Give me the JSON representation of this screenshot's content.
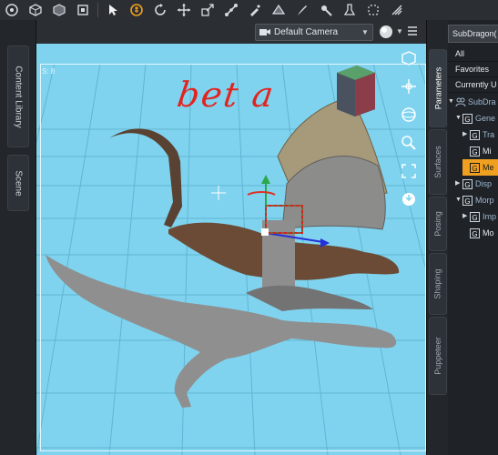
{
  "toolbar": {
    "items": [
      {
        "icon": "universal-tool-icon"
      },
      {
        "icon": "node-cube-icon"
      },
      {
        "icon": "surface-cube-icon"
      },
      {
        "icon": "region-cube-icon"
      },
      {
        "icon": "pointer-arrow-icon"
      },
      {
        "icon": "active-pose-icon"
      },
      {
        "icon": "rotate-icon"
      },
      {
        "icon": "translate-icon"
      },
      {
        "icon": "scale-icon"
      },
      {
        "icon": "joint-editor-icon"
      },
      {
        "icon": "geometry-sculptor-icon"
      },
      {
        "icon": "surface-selection-icon"
      },
      {
        "icon": "node-weight-brush-icon"
      },
      {
        "icon": "geometry-editor-icon"
      },
      {
        "icon": "spot-render-icon"
      },
      {
        "icon": "shape-move-icon"
      },
      {
        "icon": "more-tools-icon"
      }
    ]
  },
  "left_dock": {
    "tabs": [
      "Content Library",
      "Scene"
    ]
  },
  "viewport": {
    "camera_label": "Default Camera",
    "frame_label": "S: 8",
    "annotation": "bet a",
    "nav_icons": [
      "perspective-cube-icon",
      "pan-icon",
      "orbit-icon",
      "zoom-icon",
      "frame-icon",
      "reset-icon"
    ]
  },
  "right_tabs": [
    "Parameters",
    "Surfaces",
    "Posing",
    "Shaping",
    "Puppeteer"
  ],
  "params": {
    "node_title": "SubDragon(",
    "filters": [
      "All",
      "Favorites",
      "Currently U"
    ],
    "tree": [
      {
        "label": "SubDra",
        "indent": 0,
        "icon": "figure",
        "expand": "▼"
      },
      {
        "label": "Gene",
        "indent": 1,
        "icon": "G",
        "expand": "▼"
      },
      {
        "label": "Tra",
        "indent": 2,
        "icon": "G",
        "expand": "▶"
      },
      {
        "label": "Mi",
        "indent": 2,
        "icon": "G",
        "expand": ""
      },
      {
        "label": "Me",
        "indent": 2,
        "icon": "G",
        "expand": "",
        "selected": true
      },
      {
        "label": "Disp",
        "indent": 1,
        "icon": "G",
        "expand": "▶"
      },
      {
        "label": "Morp",
        "indent": 1,
        "icon": "G",
        "expand": "▼"
      },
      {
        "label": "Imp",
        "indent": 2,
        "icon": "G",
        "expand": "▶"
      },
      {
        "label": "Mo",
        "indent": 2,
        "icon": "G",
        "expand": ""
      }
    ]
  },
  "colors": {
    "viewport_bg": "#7fd3ef",
    "selection": "#f0a020",
    "annotation": "#e2241f"
  }
}
